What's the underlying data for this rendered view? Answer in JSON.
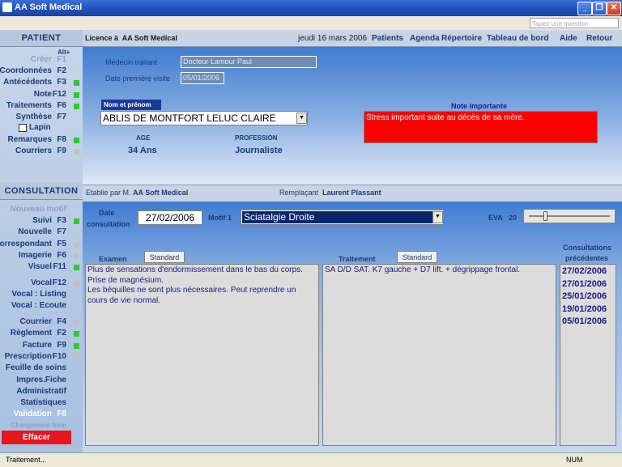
{
  "window": {
    "title": "AA Soft Medical"
  },
  "menu": {
    "ask_placeholder": "Tapez une question"
  },
  "left": {
    "patient_header": "PATIENT",
    "altplus": "Alt+",
    "patient_items": [
      {
        "label": "Créer",
        "key": "F1",
        "indicator": null
      },
      {
        "label": "Coordonnées",
        "key": "F2",
        "indicator": null
      },
      {
        "label": "Antécédents",
        "key": "F3",
        "indicator": "green"
      },
      {
        "label": "Note",
        "key": "F12",
        "indicator": "green"
      },
      {
        "label": "Traitements",
        "key": "F6",
        "indicator": "green"
      },
      {
        "label": "Synthèse",
        "key": "F7",
        "indicator": null
      }
    ],
    "lapin_label": "Lapin",
    "patient_items2": [
      {
        "label": "Remarques",
        "key": "F8",
        "indicator": "green"
      },
      {
        "label": "Courriers",
        "key": "F9",
        "indicator": "gray"
      }
    ],
    "consultation_header": "CONSULTATION",
    "cons_items": [
      {
        "label": "Nouveau motif",
        "key": "",
        "indicator": null
      },
      {
        "label": "Suivi",
        "key": "F3",
        "indicator": "green"
      },
      {
        "label": "Nouvelle",
        "key": "F7",
        "indicator": null
      },
      {
        "label": "Correspondant",
        "key": "F5",
        "indicator": "gray"
      },
      {
        "label": "Imagerie",
        "key": "F6",
        "indicator": "gray"
      },
      {
        "label": "Visuel",
        "key": "F11",
        "indicator": "green"
      }
    ],
    "vocal_items": [
      {
        "label": "Vocal",
        "key": "F12",
        "indicator": "gray"
      },
      {
        "label": "Vocal : Listing",
        "key": "",
        "indicator": null
      },
      {
        "label": "Vocal : Ecoute",
        "key": "",
        "indicator": null
      }
    ],
    "bottom_items": [
      {
        "label": "Courrier",
        "key": "F4",
        "indicator": "gray"
      },
      {
        "label": "Règlement",
        "key": "F2",
        "indicator": "green"
      },
      {
        "label": "Facture",
        "key": "F9",
        "indicator": "green"
      },
      {
        "label": "Prescription",
        "key": "F10",
        "indicator": "gray"
      },
      {
        "label": "Feuille de soins",
        "key": "",
        "indicator": null
      },
      {
        "label": "Impres.Fiche",
        "key": "",
        "indicator": null
      },
      {
        "label": "Administratif",
        "key": "",
        "indicator": null
      },
      {
        "label": "Statistiques",
        "key": "",
        "indicator": null
      },
      {
        "label": "Validation",
        "key": "F8",
        "indicator": null
      },
      {
        "label": "Changement Nom",
        "key": "",
        "indicator": null
      }
    ],
    "effacer": "Effacer"
  },
  "header": {
    "licence_prefix": "Licence à",
    "licence_name": "AA Soft Medical",
    "date": "jeudi 16 mars 2006",
    "nav": [
      "Patients",
      "Agenda",
      "Répertoire",
      "Tableau de bord",
      "Aide",
      "Retour"
    ]
  },
  "patient": {
    "medecin_label": "Médecin traitant",
    "medecin_value": "Docteur Lamour Paul",
    "first_visit_label": "Date première visite",
    "first_visit_value": "05/01/2006",
    "name_label": "Nom et prénom",
    "name_value": "ABLIS DE MONTFORT LELUC CLAIRE",
    "age_label": "AGE",
    "age_value": "34 Ans",
    "profession_label": "PROFESSION",
    "profession_value": "Journaliste",
    "note_label": "Note importante",
    "note_value": "Stress important suite au décès de sa mère."
  },
  "consultation": {
    "etablie_prefix": "Etablie par M.",
    "etablie_name": "AA Soft Medical",
    "remplacant_label": "Remplaçant",
    "remplacant_name": "Laurent Plassant",
    "date_label_1": "Date",
    "date_label_2": "consultation",
    "date_value": "27/02/2006",
    "motif_label": "Motif 1",
    "motif_value": "Sciatalgie Droite",
    "eva_label": "EVA",
    "eva_value": "20",
    "eva_level": 0.2,
    "examen_label": "Examen",
    "standard_label": "Standard",
    "examen_text": "Plus de sensations d'endormissement dans le bas du corps.\nPrise de magnésium.\nLes béquilles ne sont plus nécessaires. Peut reprendre un cours de vie normal.",
    "traitement_label": "Traitement",
    "traitement_text": "SA D/D SAT. K7 gauche + D7 lift. + dégrippage frontal.",
    "previous_label_1": "Consultations",
    "previous_label_2": "précédentes",
    "previous": [
      "27/02/2006",
      "27/01/2006",
      "25/01/2006",
      "19/01/2006",
      "05/01/2006"
    ]
  },
  "status": {
    "left": "Traitement...",
    "num": "NUM"
  },
  "colors": {
    "note_bg": "#ff0000",
    "effacer_bg": "#e8141e",
    "indicator_green": "#2fc82f"
  }
}
